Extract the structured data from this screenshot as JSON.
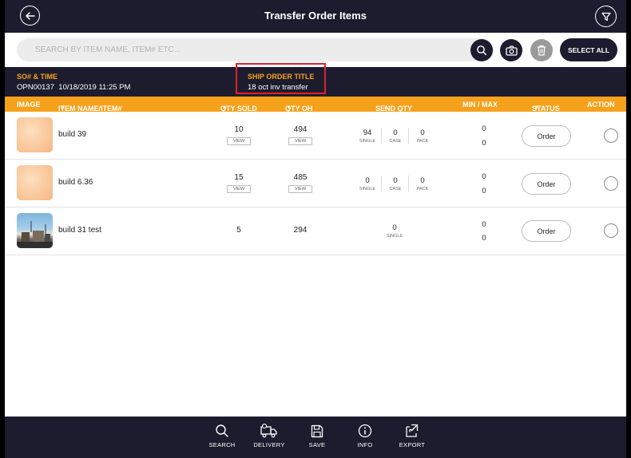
{
  "header": {
    "title": "Transfer Order Items",
    "back_icon": "arrow-left-icon",
    "filter_icon": "funnel-icon"
  },
  "search": {
    "placeholder": "SEARCH BY ITEM NAME, ITEM# ETC...",
    "value": "",
    "select_all_label": "SELECT ALL"
  },
  "info": {
    "so_label": "SO# & TIME",
    "so_value": "OPN00137  10/18/2019 11:25 PM",
    "ship_label": "SHIP ORDER TITLE",
    "ship_value": "18 oct inv transfer"
  },
  "columns": {
    "image": "IMAGE",
    "item": "ITEM NAME/ITEM#",
    "qty_sold": "QTY SOLD",
    "qty_oh": "QTY OH",
    "send_qty": "SEND QTY",
    "minmax": "MIN / MAX",
    "status": "STATUS",
    "action": "ACTION"
  },
  "rows": [
    {
      "name": "build 39",
      "qty_sold": "10",
      "qty_sold_view": "VIEW",
      "qty_oh": "494",
      "qty_oh_view": "VIEW",
      "single": "94",
      "single_label": "SINGLE",
      "case": "0",
      "case_label": "CASE",
      "pack": "0",
      "pack_label": "PACK",
      "min": "0",
      "max": "0",
      "status": "Order"
    },
    {
      "name": "build 6.36",
      "qty_sold": "15",
      "qty_sold_view": "VIEW",
      "qty_oh": "485",
      "qty_oh_view": "VIEW",
      "single": "0",
      "single_label": "SINGLE",
      "case": "0",
      "case_label": "CASE",
      "pack": "0",
      "pack_label": "PACK",
      "min": "0",
      "max": "0",
      "status": "Order"
    },
    {
      "name": "build 31 test",
      "qty_sold": "5",
      "qty_oh": "294",
      "single": "0",
      "single_label": "SINGLE",
      "min": "0",
      "max": "0",
      "status": "Order"
    }
  ],
  "bottom_tabs": [
    {
      "label": "SEARCH",
      "icon": "search-icon"
    },
    {
      "label": "DELIVERY",
      "icon": "truck-icon"
    },
    {
      "label": "SAVE",
      "icon": "save-icon"
    },
    {
      "label": "INFO",
      "icon": "info-icon"
    },
    {
      "label": "EXPORT",
      "icon": "export-icon"
    }
  ],
  "colors": {
    "dark": "#1d1c2e",
    "accent": "#f5a11c",
    "highlight": "#e0202a"
  }
}
